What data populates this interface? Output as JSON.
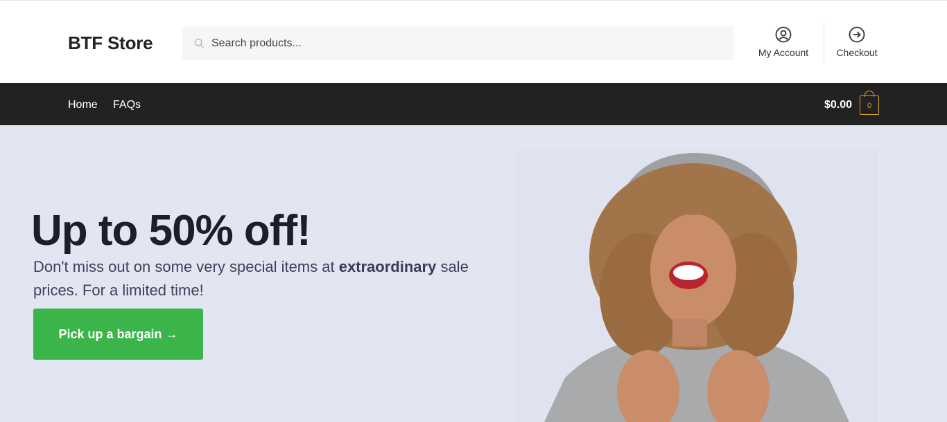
{
  "header": {
    "logo": "BTF Store",
    "search": {
      "placeholder": "Search products...",
      "icon": "search-icon"
    },
    "account_label": "My Account",
    "checkout_label": "Checkout"
  },
  "nav": {
    "items": [
      {
        "label": "Home"
      },
      {
        "label": "FAQs"
      }
    ],
    "cart_total": "$0.00",
    "cart_count": "0"
  },
  "hero": {
    "title": "Up to 50% off!",
    "text_before": "Don't miss out on some very special items at ",
    "text_bold": "extraordinary",
    "text_after": " sale prices. For a limited time!",
    "cta_label": "Pick up a bargain →"
  },
  "colors": {
    "navbar": "#222222",
    "hero_bg": "#e1e6f1",
    "cta": "#3bb54a",
    "cart_accent": "#d6a220"
  }
}
